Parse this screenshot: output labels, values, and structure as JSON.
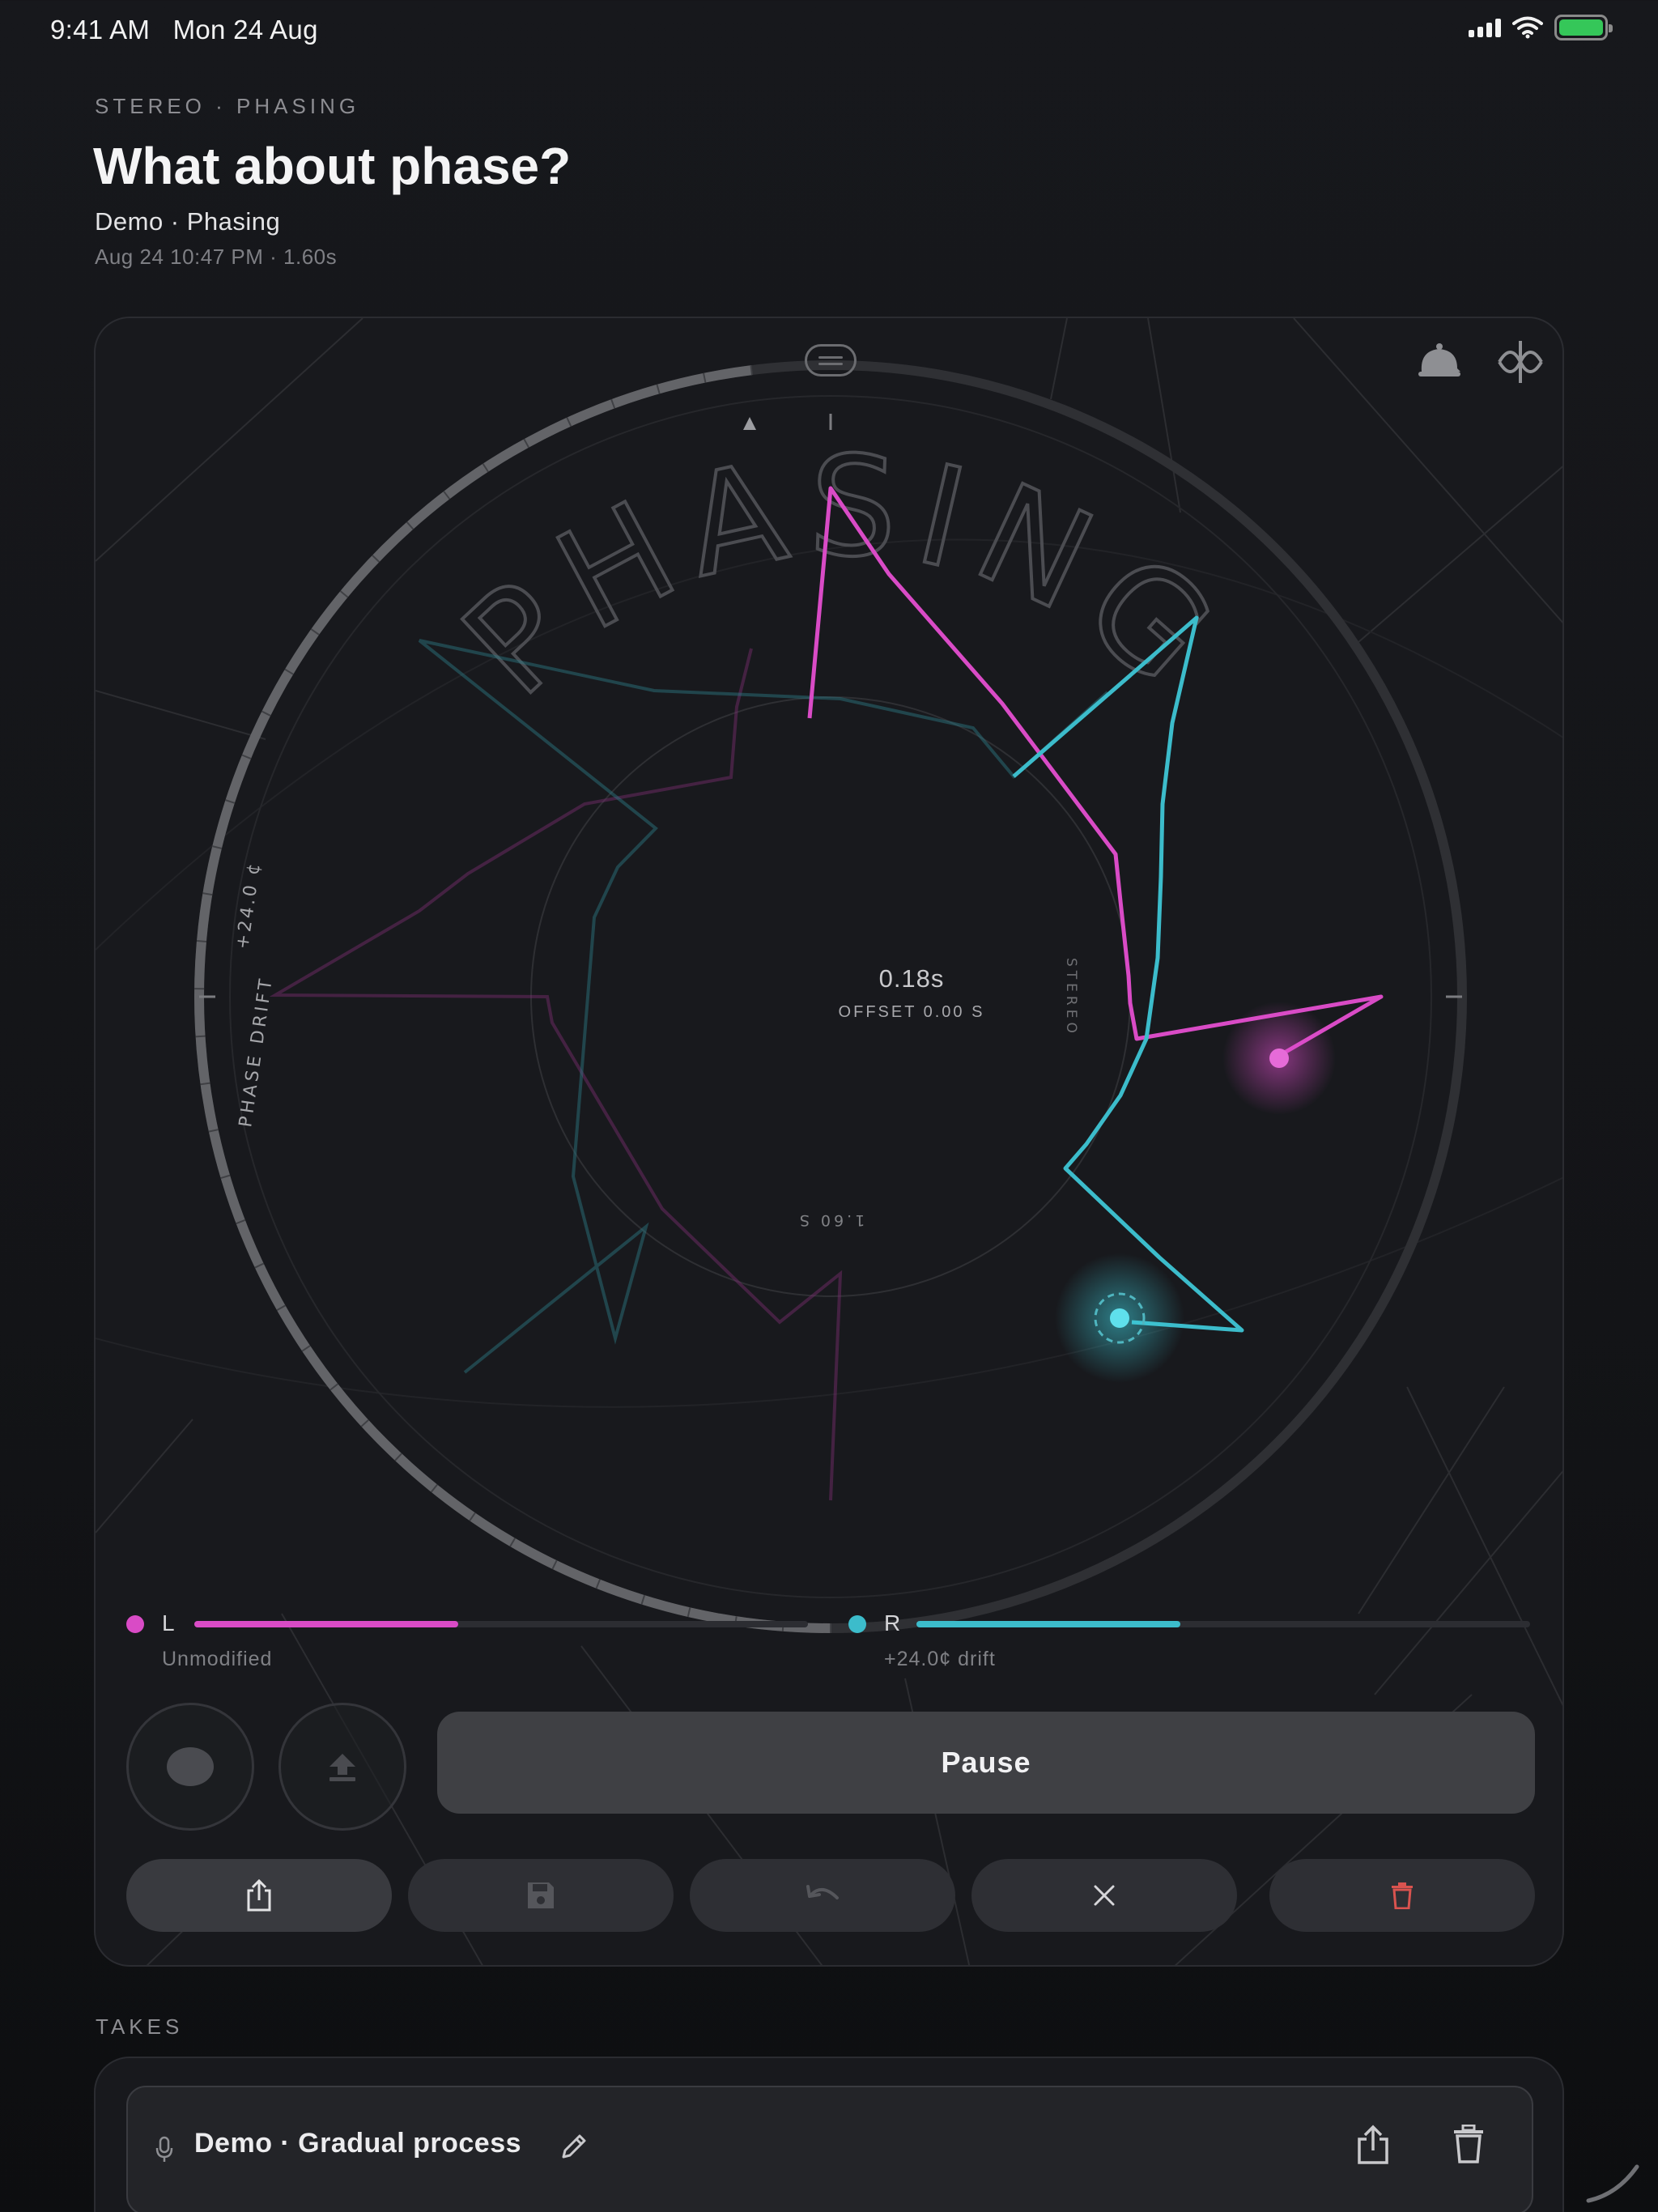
{
  "status_bar": {
    "time": "9:41 AM",
    "date": "Mon 24 Aug"
  },
  "header": {
    "eyebrow": "STEREO · PHASING",
    "title": "What about phase?",
    "session_name": "Demo · Phasing",
    "session_meta": "Aug 24 10:47 PM · 1.60s"
  },
  "dial": {
    "word": "PHASING",
    "value": "0.18s",
    "offset": "OFFSET 0.00 S",
    "side_label": "STEREO",
    "bottom_label": "1.60 S",
    "drift_label": "PHASE DRIFT",
    "drift_value": "+24.0 ¢",
    "progress": 0.48
  },
  "channels": {
    "left": {
      "letter": "L",
      "status": "Unmodified",
      "level": 0.43,
      "color": "#d94bc6"
    },
    "right": {
      "letter": "R",
      "status": "+24.0¢ drift",
      "level": 0.43,
      "color": "#3cbccb"
    }
  },
  "transport": {
    "pause_label": "Pause"
  },
  "takes": {
    "section_label": "TAKES",
    "items": [
      {
        "title": "Demo · Gradual process"
      }
    ]
  },
  "icons": {
    "menu": "menu-pill-icon",
    "bell": "bell-icon",
    "wave": "wave-icon",
    "record": "record-icon",
    "upload": "upload-icon",
    "share": "share-icon",
    "save": "save-icon",
    "undo": "undo-icon",
    "close": "close-icon",
    "trash": "trash-icon",
    "mic": "mic-icon",
    "edit": "pencil-icon"
  }
}
